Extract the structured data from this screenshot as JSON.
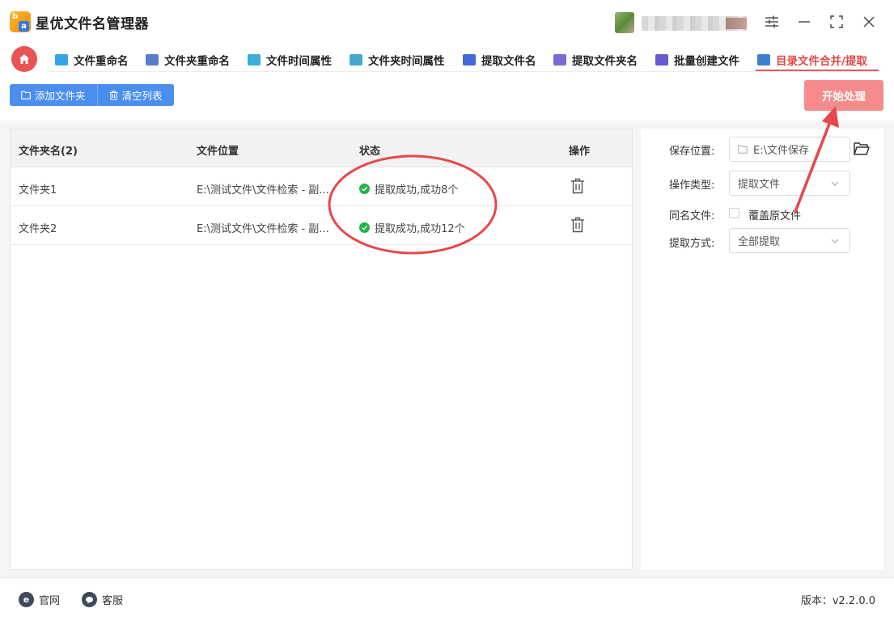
{
  "app": {
    "title": "星优文件名管理器",
    "logo_b": "b",
    "logo_a": "a"
  },
  "tabs": [
    {
      "label": "文件重命名",
      "color": "#36a3e8"
    },
    {
      "label": "文件夹重命名",
      "color": "#5a7fc8"
    },
    {
      "label": "文件时间属性",
      "color": "#3ab0d8"
    },
    {
      "label": "文件夹时间属性",
      "color": "#45a6d0"
    },
    {
      "label": "提取文件名",
      "color": "#3f6ad8"
    },
    {
      "label": "提取文件夹名",
      "color": "#7a6ad8"
    },
    {
      "label": "批量创建文件",
      "color": "#6a5ad0"
    },
    {
      "label": "目录文件合并/提取",
      "color": "#3f7fd0"
    }
  ],
  "toolbar": {
    "add_folder": "添加文件夹",
    "clear_list": "清空列表",
    "start": "开始处理"
  },
  "table": {
    "headers": [
      "文件夹名(2)",
      "文件位置",
      "状态",
      "操作"
    ],
    "rows": [
      {
        "name": "文件夹1",
        "location": "E:\\测试文件\\文件检索 - 副...",
        "status": "提取成功,成功8个"
      },
      {
        "name": "文件夹2",
        "location": "E:\\测试文件\\文件检索 - 副...",
        "status": "提取成功,成功12个"
      }
    ]
  },
  "settings": {
    "save_location_label": "保存位置:",
    "save_location_value": "E:\\文件保存",
    "operation_type_label": "操作类型:",
    "operation_type_value": "提取文件",
    "same_name_label": "同名文件:",
    "overwrite_label": "覆盖原文件",
    "extract_mode_label": "提取方式:",
    "extract_mode_value": "全部提取"
  },
  "footer": {
    "website": "官网",
    "support": "客服",
    "version": "版本：v2.2.0.0"
  },
  "colors": {
    "accent_red": "#e65a5a",
    "primary_blue": "#4a8ef0",
    "start_button": "#f58b8b",
    "success_green": "#21b34b",
    "annotation_red": "#e8474a"
  }
}
